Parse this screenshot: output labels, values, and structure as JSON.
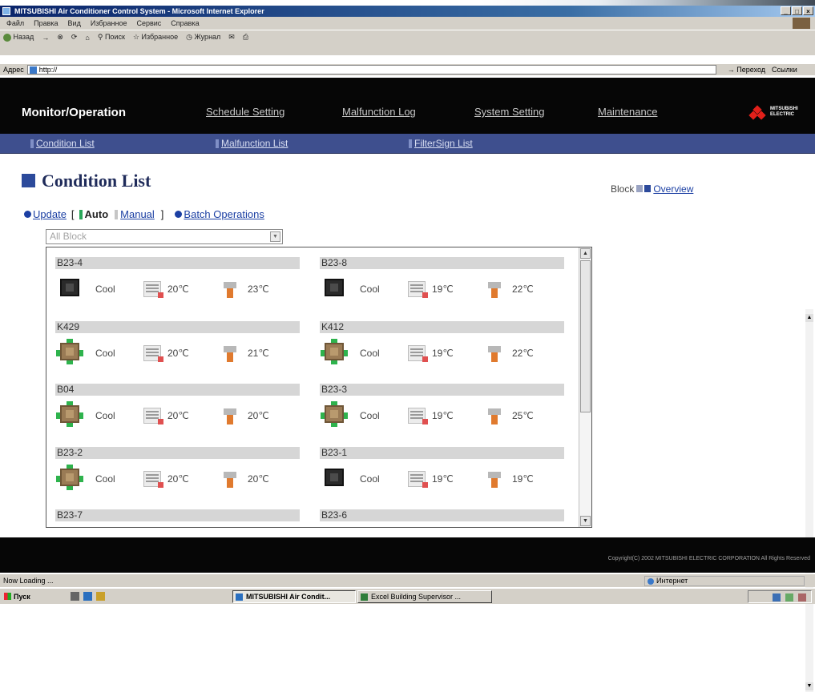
{
  "browser": {
    "title": "MITSUBISHI Air Conditioner Control System - Microsoft Internet Explorer",
    "menu": [
      "Файл",
      "Правка",
      "Вид",
      "Избранное",
      "Сервис",
      "Справка"
    ],
    "toolbar": [
      "Назад",
      "Поиск",
      "Избранное",
      "Журнал"
    ],
    "address_label": "Адрес",
    "address_value": "http://",
    "go_label": "Переход",
    "links_label": "Ссылки"
  },
  "app": {
    "tabs": {
      "active": "Monitor/Operation",
      "schedule": "Schedule Setting",
      "malfunction_log": "Malfunction Log",
      "system": "System Setting",
      "maintenance": "Maintenance"
    },
    "logo_text": "MITSUBISHI ELECTRIC",
    "subnav": {
      "condition": "Condition List",
      "malfunction": "Malfunction List",
      "filter": "FilterSign List"
    },
    "page_title": "Condition List",
    "block_label": "Block",
    "overview_link": "Overview",
    "update_link": "Update",
    "bracket_open": "[",
    "bracket_close": "]",
    "auto_label": "Auto",
    "manual_label": "Manual",
    "batch_link": "Batch Operations",
    "block_select": "All Block",
    "copyright": "Copyright(C) 2002 MITSUBISHI ELECTRIC CORPORATION All Rights Reserved"
  },
  "units": [
    {
      "name": "B23-4",
      "mode": "Cool",
      "set_temp": "20℃",
      "room_temp": "23℃",
      "state": "off"
    },
    {
      "name": "B23-8",
      "mode": "Cool",
      "set_temp": "19℃",
      "room_temp": "22℃",
      "state": "off"
    },
    {
      "name": "K429",
      "mode": "Cool",
      "set_temp": "20℃",
      "room_temp": "21℃",
      "state": "on"
    },
    {
      "name": "K412",
      "mode": "Cool",
      "set_temp": "19℃",
      "room_temp": "22℃",
      "state": "on"
    },
    {
      "name": "B04",
      "mode": "Cool",
      "set_temp": "20℃",
      "room_temp": "20℃",
      "state": "on"
    },
    {
      "name": "B23-3",
      "mode": "Cool",
      "set_temp": "19℃",
      "room_temp": "25℃",
      "state": "on"
    },
    {
      "name": "B23-2",
      "mode": "Cool",
      "set_temp": "20℃",
      "room_temp": "20℃",
      "state": "on"
    },
    {
      "name": "B23-1",
      "mode": "Cool",
      "set_temp": "19℃",
      "room_temp": "19℃",
      "state": "off"
    },
    {
      "name": "B23-7"
    },
    {
      "name": "B23-6"
    }
  ],
  "status": {
    "message": "Now Loading ...",
    "zone": "Интернет"
  },
  "taskbar": {
    "start": "Пуск",
    "tasks": [
      "MITSUBISHI Air Condit...",
      "Excel Building Supervisor ..."
    ]
  }
}
